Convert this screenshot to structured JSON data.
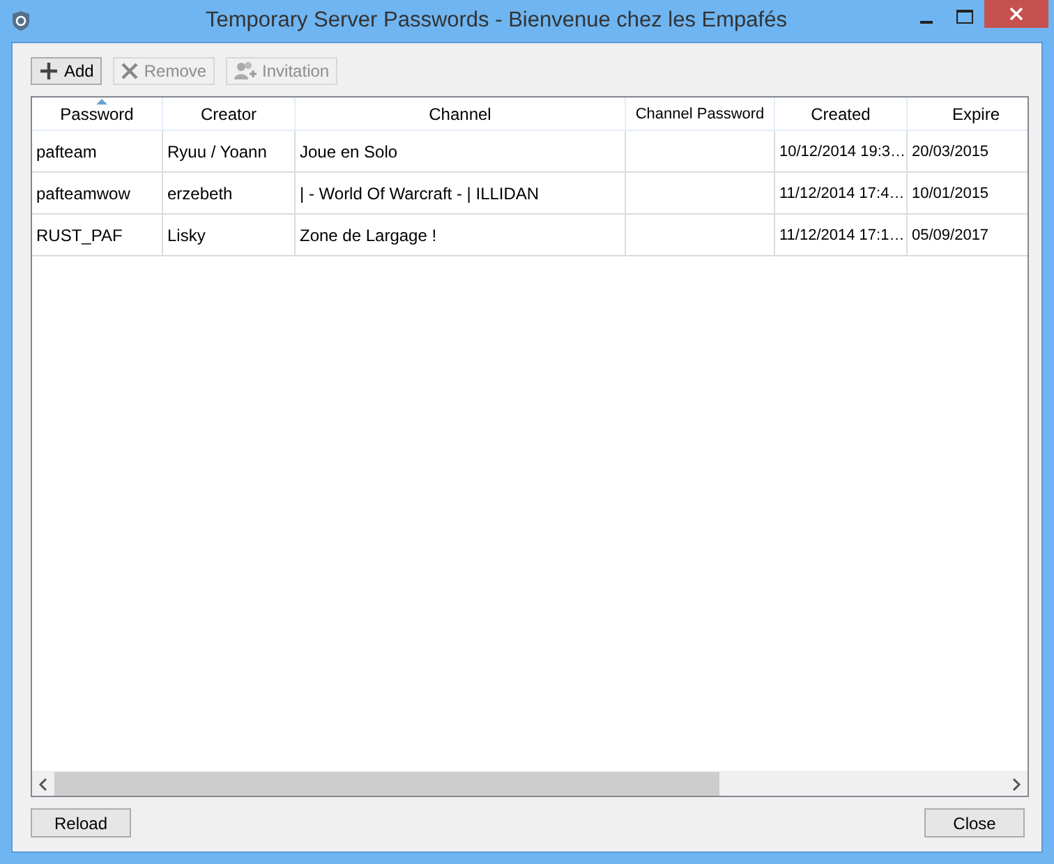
{
  "window": {
    "title": "Temporary Server Passwords - Bienvenue chez les Empafés"
  },
  "toolbar": [
    {
      "label": "Add",
      "kind": "add",
      "disabled": false
    },
    {
      "label": "Remove",
      "kind": "remove",
      "disabled": true
    },
    {
      "label": "Invitation",
      "kind": "invite",
      "disabled": true
    }
  ],
  "table": {
    "columns": [
      {
        "label": "Password",
        "sorted": true
      },
      {
        "label": "Creator",
        "sorted": false
      },
      {
        "label": "Channel",
        "sorted": false
      },
      {
        "label": "Channel Password",
        "sorted": false
      },
      {
        "label": "Created",
        "sorted": false
      },
      {
        "label": "Expire",
        "sorted": false
      }
    ],
    "rows": [
      [
        "pafteam",
        "Ryuu / Yoann",
        "Joue en Solo",
        "",
        "10/12/2014 19:3…",
        "20/03/2015"
      ],
      [
        "pafteamwow",
        "erzebeth",
        "| - World Of Warcraft - | ILLIDAN",
        "",
        "11/12/2014 17:4…",
        "10/01/2015"
      ],
      [
        "RUST_PAF",
        "Lisky",
        "Zone de Largage !",
        "",
        "11/12/2014 17:1…",
        "05/09/2017"
      ]
    ]
  },
  "buttons": {
    "left": "Reload",
    "right": "Close"
  }
}
